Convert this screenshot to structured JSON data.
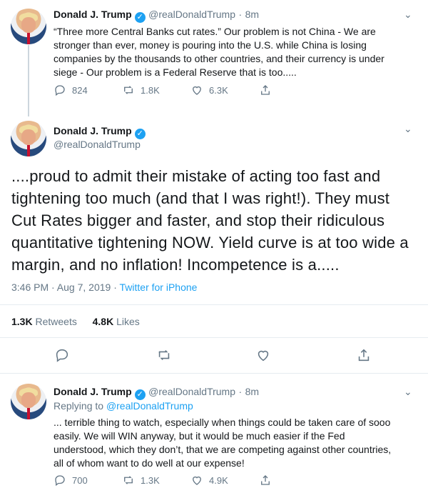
{
  "tweet1": {
    "name": "Donald J. Trump",
    "handle": "@realDonaldTrump",
    "separator": "·",
    "time": "8m",
    "text_lines": [
      "“Three more Central Banks cut rates.” Our problem is not China - We are",
      "stronger than ever, money is pouring into the U.S. while China is losing",
      "companies by the thousands to other countries, and their currency is under",
      "siege - Our problem is a Federal Reserve that is too....."
    ],
    "replies": "824",
    "retweets": "1.8K",
    "likes": "6.3K"
  },
  "tweet2": {
    "name": "Donald J. Trump",
    "handle": "@realDonaldTrump",
    "text_lines": [
      "....proud to admit their mistake of acting too fast and",
      "tightening too much (and that I was right!). They must",
      "Cut Rates bigger and faster, and stop their ridiculous",
      "quantitative tightening NOW. Yield curve is at too wide a",
      "margin, and no inflation! Incompetence is a....."
    ],
    "timestamp": "3:46 PM · Aug 7, 2019 · ",
    "source": "Twitter for iPhone",
    "retweets_count": "1.3K",
    "retweets_label": "Retweets",
    "likes_count": "4.8K",
    "likes_label": "Likes"
  },
  "tweet3": {
    "name": "Donald J. Trump",
    "handle": "@realDonaldTrump",
    "separator": "·",
    "time": "8m",
    "replying_prefix": "Replying to ",
    "replying_handle": "@realDonaldTrump",
    "text_lines": [
      "... terrible thing to watch, especially when things could be taken care of sooo",
      "easily. We will WIN anyway, but it would be much easier if the Fed",
      "understood, which they don’t, that we are competing against other countries,",
      "all of whom want to do well at our expense!"
    ],
    "replies": "700",
    "retweets": "1.3K",
    "likes": "4.9K"
  },
  "colors": {
    "accent": "#1da1f2",
    "muted": "#657786",
    "text": "#14171a"
  },
  "icons": [
    "verified-badge-icon",
    "chevron-down-icon",
    "reply-icon",
    "retweet-icon",
    "like-icon",
    "share-icon"
  ]
}
